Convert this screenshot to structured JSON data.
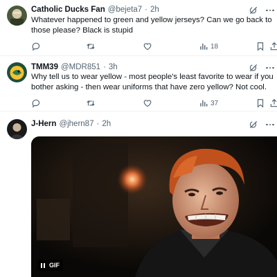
{
  "tweets": [
    {
      "name": "Catholic Ducks Fan",
      "handle": "@bejeta7",
      "separator": "·",
      "time": "2h",
      "text": "Whatever happened to green and yellow jerseys? Can we go back to those please? Black is stupid",
      "views": "18"
    },
    {
      "name": "TMM39",
      "handle": "@MDR851",
      "separator": "·",
      "time": "3h",
      "text": "Why tell us to wear yellow - most people's least favorite to wear if you bother asking - then wear uniforms that have zero yellow? Not cool.",
      "views": "37"
    },
    {
      "name": "J-Hern",
      "handle": "@jhern87",
      "separator": "·",
      "time": "2h",
      "media_label": "GIF"
    }
  ],
  "icons": {
    "reply": "reply-icon",
    "retweet": "retweet-icon",
    "like": "heart-icon",
    "views": "views-icon",
    "bookmark": "bookmark-icon",
    "share": "share-icon",
    "grok": "grok-icon",
    "more": "more-icon"
  },
  "colors": {
    "text": "#0f1419",
    "secondary": "#536471",
    "divider": "#eff3f4"
  }
}
